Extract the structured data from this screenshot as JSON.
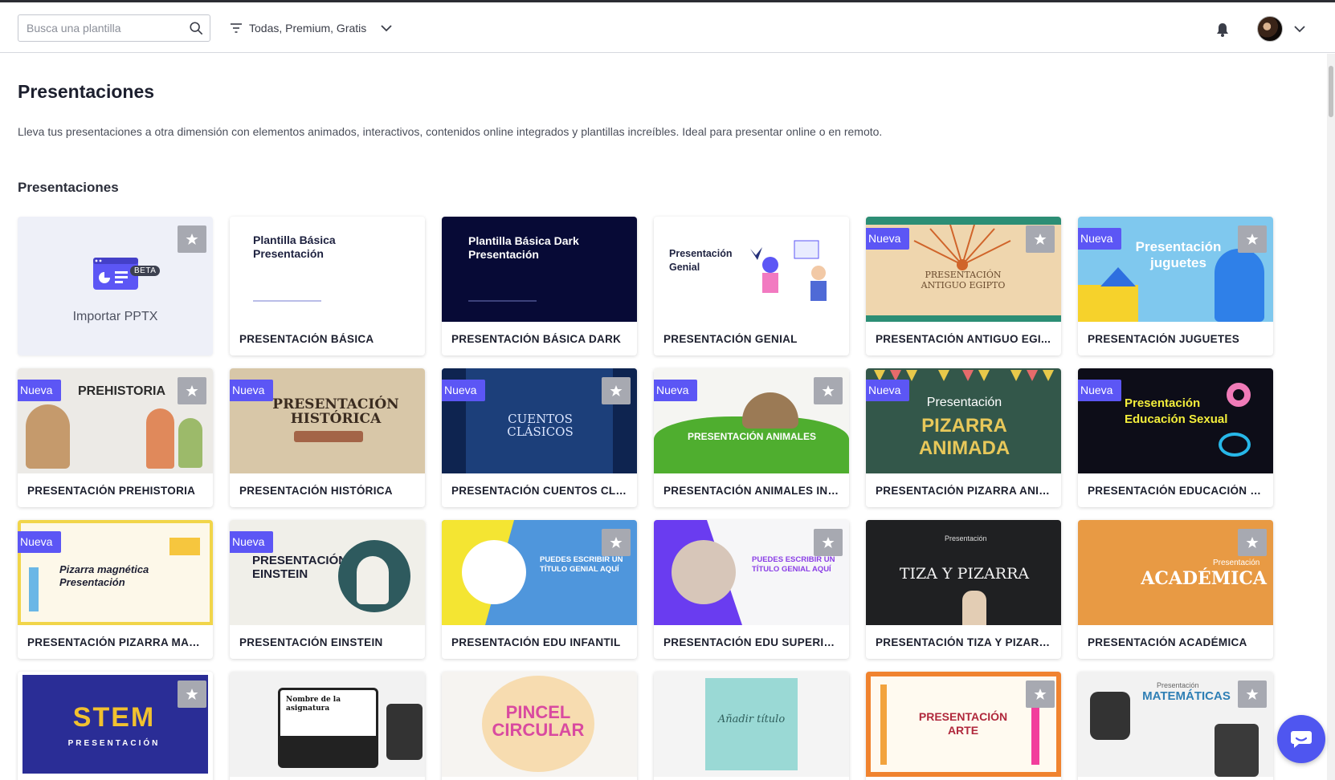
{
  "header": {
    "search_placeholder": "Busca una plantilla",
    "filter_label": "Todas, Premium, Gratis"
  },
  "page": {
    "title": "Presentaciones",
    "description": "Lleva tus presentaciones a otra dimensión con elementos animados, interactivos, contenidos online integrados y plantillas increíbles. Ideal para presentar online o en remoto.",
    "section_title": "Presentaciones"
  },
  "import_card": {
    "label": "Importar PPTX",
    "badge": "BETA"
  },
  "badge_new": "Nueva",
  "cards": [
    {
      "label": "PRESENTACIÓN BÁSICA",
      "thumb_title": "Plantilla Básica Presentación"
    },
    {
      "label": "PRESENTACIÓN BÁSICA DARK",
      "thumb_title": "Plantilla Básica Dark Presentación"
    },
    {
      "label": "PRESENTACIÓN GENIAL",
      "thumb_title": "Presentación Genial"
    },
    {
      "label": "PRESENTACIÓN ANTIGUO EGI...",
      "thumb_title": "PRESENTACIÓN ANTIGUO EGIPTO",
      "new": true,
      "fav": true
    },
    {
      "label": "PRESENTACIÓN JUGUETES",
      "thumb_title": "Presentación juguetes",
      "new": true,
      "fav": true
    },
    {
      "label": "PRESENTACIÓN PREHISTORIA",
      "thumb_title": "PREHISTORIA",
      "new": true,
      "fav": true
    },
    {
      "label": "PRESENTACIÓN HISTÓRICA",
      "thumb_title": "PRESENTACIÓN HISTÓRICA",
      "new": true
    },
    {
      "label": "PRESENTACIÓN CUENTOS CLÁ...",
      "thumb_title": "CUENTOS CLÁSICOS",
      "new": true,
      "fav": true
    },
    {
      "label": "PRESENTACIÓN ANIMALES INF...",
      "thumb_title": "PRESENTACIÓN ANIMALES",
      "new": true,
      "fav": true
    },
    {
      "label": "PRESENTACIÓN PIZARRA ANIM...",
      "thumb_title": "PIZARRA ANIMADA",
      "new": true
    },
    {
      "label": "PRESENTACIÓN EDUCACIÓN S...",
      "thumb_title": "Presentación Educación Sexual",
      "new": true
    },
    {
      "label": "PRESENTACIÓN PIZARRA MAG...",
      "thumb_title": "Pizarra magnética Presentación",
      "new": true
    },
    {
      "label": "PRESENTACIÓN EINSTEIN",
      "thumb_title": "PRESENTACIÓN EINSTEIN",
      "new": true
    },
    {
      "label": "PRESENTACIÓN EDU INFANTIL",
      "thumb_title": "PUEDES ESCRIBIR UN TÍTULO GENIAL AQUÍ",
      "fav": true
    },
    {
      "label": "PRESENTACIÓN EDU SUPERIOR",
      "thumb_title": "PUEDES ESCRIBIR UN TÍTULO GENIAL AQUÍ",
      "fav": true
    },
    {
      "label": "PRESENTACIÓN TIZA Y PIZARRA",
      "thumb_title": "TIZA Y PIZARRA"
    },
    {
      "label": "PRESENTACIÓN ACADÉMICA",
      "thumb_title": "ACADÉMICA",
      "fav": true
    },
    {
      "thumb_title": "STEM",
      "fav": true
    },
    {
      "thumb_title": "Nombre de la asignatura"
    },
    {
      "thumb_title": "PINCEL CIRCULAR"
    },
    {
      "thumb_title": "Añadir título"
    },
    {
      "thumb_title": "PRESENTACIÓN ARTE",
      "fav": true
    },
    {
      "thumb_title": "MATEMÁTICAS",
      "fav": true
    }
  ],
  "colors": {
    "accent": "#5c56f5",
    "chat": "#4f56f0"
  }
}
